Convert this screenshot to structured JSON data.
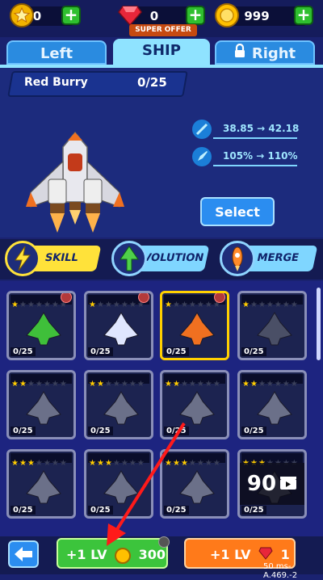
{
  "currencies": {
    "stars": "0",
    "gems": "0",
    "coins": "999"
  },
  "super_offer": "SUPER OFFER",
  "tabs": {
    "left": "Left",
    "ship": "SHIP",
    "right": "Right"
  },
  "ship": {
    "name": "Red Burry",
    "progress": "0/25",
    "stat1": "38.85 → 42.18",
    "stat2": "105% → 110%",
    "select_label": "Select"
  },
  "modes": {
    "skill": "SKILL",
    "evolution": "EVOLUTION",
    "merge": "MERGE"
  },
  "cards": [
    {
      "stars": 1,
      "progress": "0/25"
    },
    {
      "stars": 1,
      "progress": "0/25"
    },
    {
      "stars": 1,
      "progress": "0/25"
    },
    {
      "stars": 1,
      "progress": "0/25"
    },
    {
      "stars": 2,
      "progress": "0/25"
    },
    {
      "stars": 2,
      "progress": "0/25"
    },
    {
      "stars": 2,
      "progress": "0/25"
    },
    {
      "stars": 2,
      "progress": "0/25"
    },
    {
      "stars": 3,
      "progress": "0/25"
    },
    {
      "stars": 3,
      "progress": "0/25"
    },
    {
      "stars": 3,
      "progress": "0/25"
    },
    {
      "stars": 3,
      "progress": "0/25"
    }
  ],
  "video_offer": "90",
  "bottom": {
    "lv_coin_label": "+1 LV",
    "lv_coin_cost": "300",
    "lv_gem_label": "+1 LV",
    "lv_gem_cost": "1",
    "version": "50 ms-A.469.-2"
  },
  "colors": {
    "accent": "#ffd000",
    "coin_button": "#3cc43c",
    "gem_button": "#ff7a1a"
  }
}
